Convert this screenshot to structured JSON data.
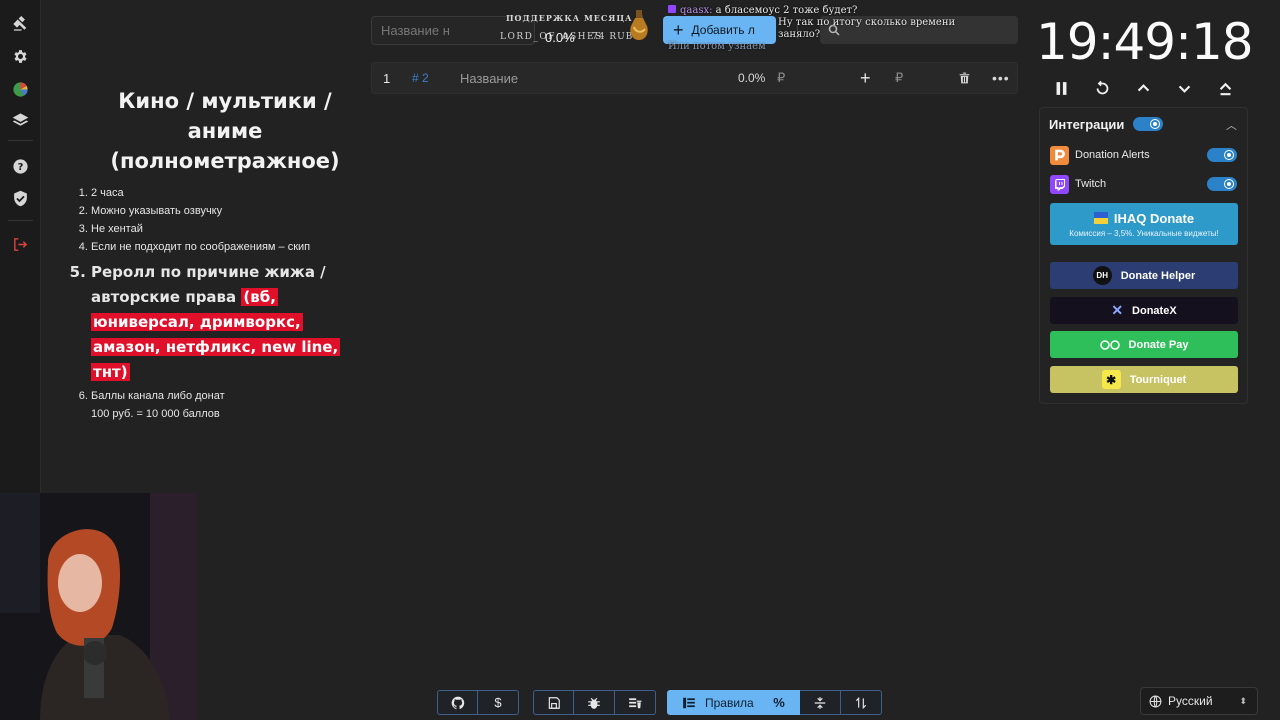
{
  "sidebar": {
    "items": [
      {
        "icon": "gavel-icon"
      },
      {
        "icon": "gear-icon"
      },
      {
        "icon": "pie-chart-icon"
      },
      {
        "icon": "layers-icon"
      },
      {
        "icon": "help-icon"
      },
      {
        "icon": "shield-check-icon"
      },
      {
        "icon": "logout-icon"
      }
    ]
  },
  "rules": {
    "title": "Кино / мультики / аниме (полнометражное)",
    "items": [
      "2 часа",
      "Можно указывать озвучку",
      "Не хентай",
      "Если не подходит по соображениям – скип"
    ],
    "item5_plain": "Реролл по причине жижа / авторские права ",
    "item5_highlight": "(вб, юниверсал, дримворкс, амазон, нетфликс, new line, тнт)",
    "item6_line1": "Баллы канала либо донат",
    "item6_line2": "100 руб. = 10 000 баллов"
  },
  "topbar": {
    "name_placeholder": "Название н",
    "monthly_title": "ПОДДЕРЖКА МЕСЯЦА ♡",
    "monthly_name": "LORD_OF_ASHES",
    "monthly_pct": "0.0%",
    "monthly_amount": "74 RUB",
    "add_lot_label": "Добавить л",
    "search_placeholder": ""
  },
  "chat": {
    "user1": "qaasx:",
    "msg1": "а бласемоус 2 тоже будет?",
    "msg2": "Ну так по итогу сколько времени заняло?",
    "msg3": "Или потом узнаем"
  },
  "lot": {
    "index": "1",
    "id": "# 2",
    "name": "Название",
    "percent": "0.0%",
    "currency": "₽"
  },
  "timer": {
    "time": "19:49:18"
  },
  "integrations": {
    "title": "Интеграции",
    "donation_alerts": "Donation Alerts",
    "twitch": "Twitch",
    "ihaq_label": "IHAQ Donate",
    "ihaq_sub": "Комиссия – 3,5%. Уникальные виджеты!",
    "donate_helper": "Donate Helper",
    "donatex": "DonateX",
    "donate_pay": "Donate Pay",
    "tourniquet": "Tourniquet",
    "colors": {
      "ihaq": "#2e9ac9",
      "donate_helper": "#2b3d72",
      "donatex": "#15101e",
      "donate_pay": "#2fbf5a",
      "tourniquet": "#c7c262"
    }
  },
  "toolbar": {
    "rules_label": "Правила"
  },
  "lang": {
    "label": "Русский"
  }
}
